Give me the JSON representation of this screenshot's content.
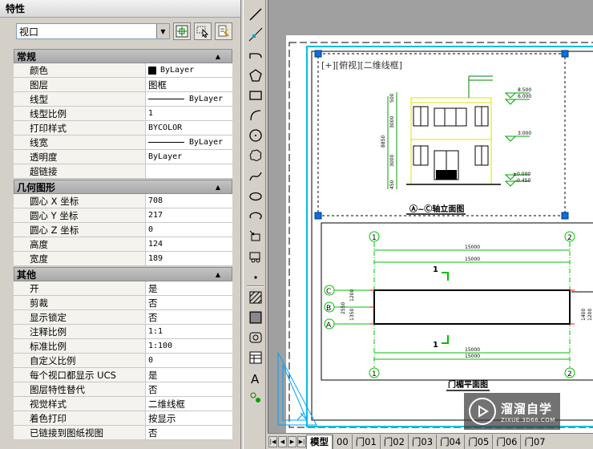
{
  "palette": {
    "title": "特性",
    "object_type": "视口",
    "sections": [
      {
        "name": "常规",
        "rows": [
          {
            "key": "颜色",
            "value": "ByLayer",
            "swatch": "#000000"
          },
          {
            "key": "图层",
            "value": "图框"
          },
          {
            "key": "线型",
            "value": "ByLayer",
            "linesample": true
          },
          {
            "key": "线型比例",
            "value": "1"
          },
          {
            "key": "打印样式",
            "value": "BYCOLOR"
          },
          {
            "key": "线宽",
            "value": "ByLayer",
            "linesample": true
          },
          {
            "key": "透明度",
            "value": "ByLayer"
          },
          {
            "key": "超链接",
            "value": ""
          }
        ]
      },
      {
        "name": "几何图形",
        "rows": [
          {
            "key": "圆心 X 坐标",
            "value": "708"
          },
          {
            "key": "圆心 Y 坐标",
            "value": "217"
          },
          {
            "key": "圆心 Z 坐标",
            "value": "0"
          },
          {
            "key": "高度",
            "value": "124"
          },
          {
            "key": "宽度",
            "value": "189"
          }
        ]
      },
      {
        "name": "其他",
        "rows": [
          {
            "key": "开",
            "value": "是"
          },
          {
            "key": "剪裁",
            "value": "否"
          },
          {
            "key": "显示锁定",
            "value": "否"
          },
          {
            "key": "注释比例",
            "value": "1:1"
          },
          {
            "key": "标准比例",
            "value": "1:100"
          },
          {
            "key": "自定义比例",
            "value": "0"
          },
          {
            "key": "每个视口都显示 UCS",
            "value": "是"
          },
          {
            "key": "图层特性替代",
            "value": "否"
          },
          {
            "key": "视觉样式",
            "value": "二维线框"
          },
          {
            "key": "着色打印",
            "value": "按显示"
          },
          {
            "key": "已链接到图纸视图",
            "value": "否"
          }
        ]
      }
    ]
  },
  "drawing": {
    "viewport_label": "[+][俯视][二维线框]",
    "elevation_title": "Ⓐ~Ⓒ轴立面图",
    "plan_title": "门楣平面图",
    "elevation_dims": [
      "8850",
      "500",
      "3000",
      "3000",
      "450"
    ],
    "level_marks": [
      "8.500",
      "6.000",
      "3.000",
      "±0.000",
      "-0.450"
    ],
    "plan_dims": [
      "15000",
      "15000",
      "15000",
      "15000"
    ],
    "side_dims": [
      "2550",
      "1350",
      "1200",
      "1400",
      "1200"
    ],
    "axis_numbers": [
      "1",
      "2",
      "1",
      "2"
    ],
    "axis_letters": [
      "C",
      "B",
      "A"
    ],
    "section_marks": [
      "1",
      "1"
    ]
  },
  "tabs": [
    "模型",
    "00",
    "门01",
    "门02",
    "门03",
    "门04",
    "门05",
    "门06",
    "门07"
  ],
  "active_tab": "模型",
  "watermark": {
    "main": "溜溜自学",
    "sub": "ZIXUE.3D66.COM"
  }
}
